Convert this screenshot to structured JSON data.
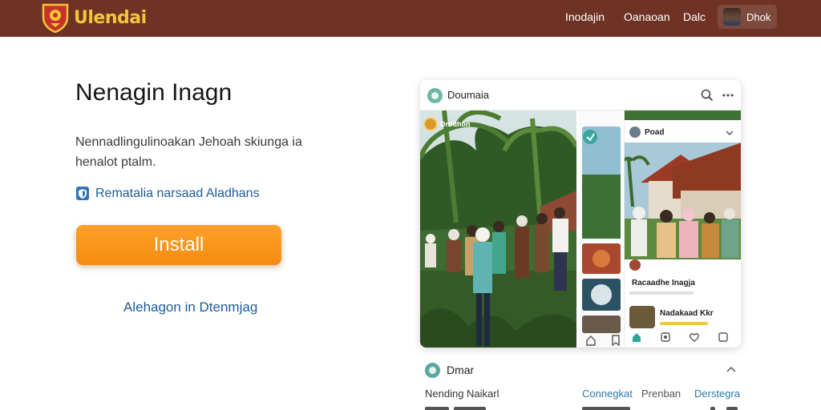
{
  "header": {
    "brand": "Ulendai",
    "nav": [
      "Inodajin",
      "Oanaoan",
      "Dalc"
    ],
    "profile_label": "Dhok",
    "bar_color": "#6e3324"
  },
  "hero": {
    "title": "Nenagin Inagn",
    "description": "Nennadlingulinoakan Jehoah skiunga ia henalot ptalm.",
    "feature": "Rematalia narsaad Aladhans",
    "install": "Install",
    "secondary_link": "Alehagon in Dtenmjag",
    "accent": "#f58b10",
    "link_color": "#1d5c9a"
  },
  "mockup": {
    "app_title": "Doumaia",
    "icons": [
      "search-icon",
      "more-icon"
    ],
    "photo_label": "Drodhon",
    "phone_user": "Poad",
    "post1_name": "Racaadhe Inagja",
    "post2_name": "Nadakaad Kkr",
    "bottom_nav": [
      "home-icon",
      "grid-icon",
      "heart-icon",
      "profile-icon"
    ]
  },
  "panel": {
    "title": "Dmar",
    "left_label": "Nending Naikarl",
    "links": [
      "Connegkat",
      "Prenban",
      "Derstegra"
    ]
  }
}
